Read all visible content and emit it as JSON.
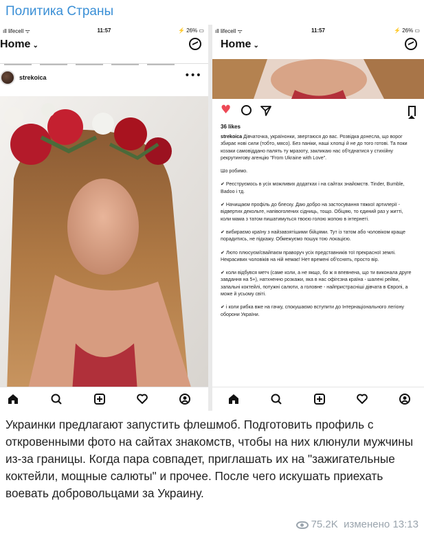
{
  "channel": {
    "title": "Политика Страны"
  },
  "phones": {
    "left": {
      "status": {
        "carrier": "ıll lifecell ᯤ",
        "time": "11:57",
        "battery": "⚡ 26% ▭"
      },
      "header": {
        "home_label": "Home",
        "chevron": "⌄"
      },
      "post": {
        "username": "strekoica",
        "more": "•••"
      }
    },
    "right": {
      "status": {
        "carrier": "ıll lifecell ᯤ",
        "time": "11:57",
        "battery": "⚡ 26% ▭"
      },
      "header": {
        "home_label": "Home",
        "chevron": "⌄"
      },
      "likes": "36 likes",
      "caption": {
        "username": "strekoica",
        "intro": "Дівчаточка, українонки, звертаюся до вас. Розвідка донесла, що ворог збирає нові сили (тобто, мясо). Без паніки, наші хлопці й не до того готові. Та поки козаки самовіддано палять ту мразоту, закликаю нас об'єднатися у стихійну рекрутингову агенцію \"From Ukraine with Love\".",
        "what_we_do": "Шо робимо.",
        "items": [
          "✔ Реєструємось в усіх можливих додатках і на сайтах знайомств. Tinder, Bumble, Badoo і тд.",
          "✔ Начищаєм профіль до блеску. Даю добро на застосування тяжкої артилерії - відвертих декольте, напівоголених сідниць, тощо. Обіцяю, то єдиний раз у житті, коли мама з татом пишатимуться твоєю голою жопою в інтернеті.",
          "✔ вибираємо країну з найзавзятішими бійцями. Тут із татом або чоловіком краще порадитись, не підкажу. Обмежуємо пошук тою локацією.",
          "✔ Люто плюсуєм/свайпаєм праворуч усіх представників тої прекрасної землі. Некрасивих чоловіків на ній немає! Нет времені об'єснять, просто вір.",
          "✔ коли відбувся метч (саме коли, а не якщо, бо ж я впевнена, що ти виконала друге завдання на 5+), натхненно розкажи, яка в нас офігєзна країна - шалені рейви, запальні коктейлі, потужні салюти, а головне - найпристрасніші дівчата в Європі, а може й усьому світі.",
          "✔ і коли рибка вже на гачку, спокушаємо вступити до Інтернаціонального легіону оборони України."
        ]
      }
    }
  },
  "post_text": "Украинки предлагают запустить флешмоб. Подготовить профиль с откровенными фото на сайтах знакомств, чтобы на них клюнули мужчины из-за границы. Когда пара совпадет, приглашать их на \"зажигательные коктейли, мощные салюты\" и прочее. После чего искушать приехать воевать добровольцами за Украину.",
  "meta": {
    "views": "75.2K",
    "edited_label": "изменено",
    "time": "13:13"
  },
  "colors": {
    "accent": "#3a8fd6",
    "like_red": "#ed4956",
    "meta_grey": "#9aa4ad"
  }
}
